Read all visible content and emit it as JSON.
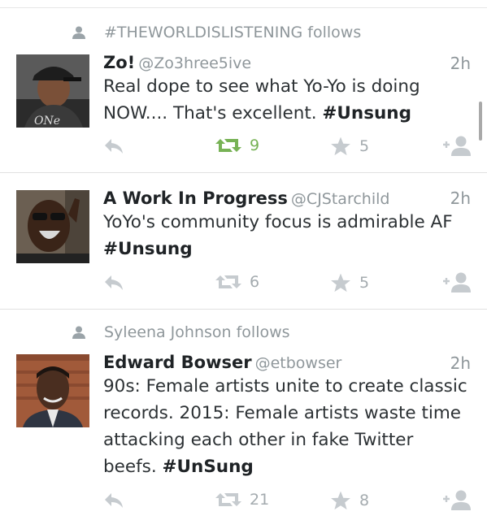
{
  "colors": {
    "retweet_active": "#77b255",
    "icon_gray": "#c6cbcf",
    "muted_text": "#8f979b"
  },
  "tweets": [
    {
      "context": "#THEWORLDISLISTENING follows",
      "name": "Zo!",
      "handle": "@Zo3hree5ive",
      "time": "2h",
      "text_before": "Real dope to see what Yo-Yo is doing NOW.... That's excellent. ",
      "hashtag": "#Unsung",
      "retweets": "9",
      "favorites": "5",
      "retweeted": true
    },
    {
      "context": "",
      "name": "A Work In Progress",
      "handle": "@CJStarchild",
      "time": "2h",
      "text_before": "YoYo's community focus is admirable AF ",
      "hashtag": "#Unsung",
      "retweets": "6",
      "favorites": "5",
      "retweeted": false
    },
    {
      "context": "Syleena Johnson follows",
      "name": "Edward Bowser",
      "handle": "@etbowser",
      "time": "2h",
      "text_before": "90s: Female artists unite to create classic records. 2015: Female artists waste time attacking each other in fake Twitter beefs. ",
      "hashtag": "#UnSung",
      "retweets": "21",
      "favorites": "8",
      "retweeted": false
    }
  ]
}
